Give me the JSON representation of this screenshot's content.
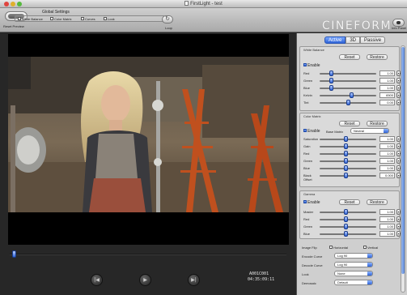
{
  "window": {
    "title": "FirstLight - test"
  },
  "toolbar": {
    "reset_preview_label": "Reset Preview",
    "global_settings_title": "Global Settings",
    "global_options": [
      {
        "label": "White Balance",
        "checked": false
      },
      {
        "label": "Color Matrix",
        "checked": false
      },
      {
        "label": "Curves",
        "checked": false
      },
      {
        "label": "Look",
        "checked": false
      }
    ],
    "loop_label": "Loop",
    "logo": "CINEFORM",
    "info_label": "Info Panel"
  },
  "player": {
    "clip_name": "A001C001",
    "timecode": "04:35:09:11",
    "scrub_progress": 0.01,
    "buttons": [
      {
        "name": "previous",
        "icon": "skip-back-icon",
        "glyph": "|◀"
      },
      {
        "name": "play",
        "icon": "play-icon",
        "glyph": "▶"
      },
      {
        "name": "next",
        "icon": "skip-forward-icon",
        "glyph": "▶|"
      }
    ]
  },
  "panel": {
    "tabs": [
      "Active",
      "3D",
      "Passive"
    ],
    "active_tab": "Active",
    "reset_label": "Reset",
    "restore_label": "Restore",
    "enable_label": "Enable",
    "white_balance": {
      "title": "White Balance",
      "rows": [
        {
          "label": "Red",
          "value": "1.00",
          "level": 0.2
        },
        {
          "label": "Green",
          "value": "1.00",
          "level": 0.2
        },
        {
          "label": "Blue",
          "value": "1.00",
          "level": 0.2
        },
        {
          "label": "Kelvin",
          "value": "6500",
          "level": 0.55
        },
        {
          "label": "Tint",
          "value": "0.00",
          "level": 0.5
        }
      ]
    },
    "color_matrix": {
      "title": "Color Matrix",
      "base_matrix_label": "Base Matrix",
      "base_matrix_value": "Neutral",
      "rows": [
        {
          "label": "Saturation",
          "value": "1.00",
          "level": 0.45
        },
        {
          "label": "Gain",
          "value": "1.00",
          "level": 0.45
        },
        {
          "label": "Red",
          "value": "1.00",
          "level": 0.45
        },
        {
          "label": "Green",
          "value": "1.00",
          "level": 0.45
        },
        {
          "label": "Blue",
          "value": "1.00",
          "level": 0.45
        },
        {
          "label": "Black Offset",
          "value": "0.000",
          "level": 0.45
        }
      ]
    },
    "gamma": {
      "title": "Gamma",
      "rows": [
        {
          "label": "Master",
          "value": "1.00",
          "level": 0.45
        },
        {
          "label": "Red",
          "value": "1.00",
          "level": 0.45
        },
        {
          "label": "Green",
          "value": "1.00",
          "level": 0.45
        },
        {
          "label": "Blue",
          "value": "1.00",
          "level": 0.45
        }
      ]
    },
    "image_flip": {
      "label": "Image Flip",
      "horizontal": "Horizontal",
      "vertical": "Vertical"
    },
    "encode_curve": {
      "label": "Encode Curve",
      "value": "Log 90"
    },
    "decode_curve": {
      "label": "Decode Curve",
      "value": "Log 90"
    },
    "look": {
      "label": "Look",
      "value": "None"
    },
    "demosaic": {
      "label": "Demosaic",
      "value": "Default"
    }
  }
}
